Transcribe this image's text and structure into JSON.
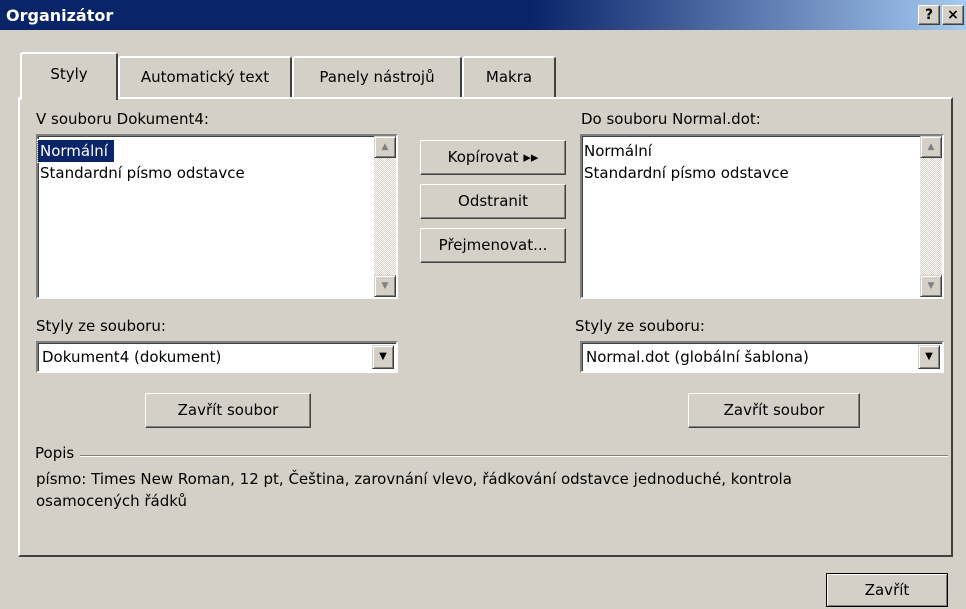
{
  "window": {
    "title": "Organizátor",
    "help_button": "?",
    "close_button": "×"
  },
  "tabs": [
    {
      "label": "Styly",
      "active": true
    },
    {
      "label": "Automatický text"
    },
    {
      "label": "Panely nástrojů"
    },
    {
      "label": "Makra"
    }
  ],
  "left": {
    "list_label": "V souboru Dokument4:",
    "items": [
      "Normální",
      "Standardní písmo odstavce"
    ],
    "selected_item": "Normální",
    "source_label": "Styly ze souboru:",
    "source_value": "Dokument4 (dokument)",
    "close_file_button": "Zavřít soubor"
  },
  "right": {
    "list_label": "Do souboru Normal.dot:",
    "items": [
      "Normální",
      "Standardní písmo odstavce"
    ],
    "source_label": "Styly ze souboru:",
    "source_value": "Normal.dot (globální šablona)",
    "close_file_button": "Zavřít soubor"
  },
  "actions": {
    "copy": "Kopírovat ▸▸",
    "delete": "Odstranit",
    "rename": "Přejmenovat..."
  },
  "description": {
    "label": "Popis",
    "text_line1": "písmo: Times New Roman, 12 pt, Čeština, zarovnání vlevo, řádkování odstavce jednoduché, kontrola",
    "text_line2": "osamocených řádků"
  },
  "footer": {
    "close_button": "Zavřít"
  }
}
